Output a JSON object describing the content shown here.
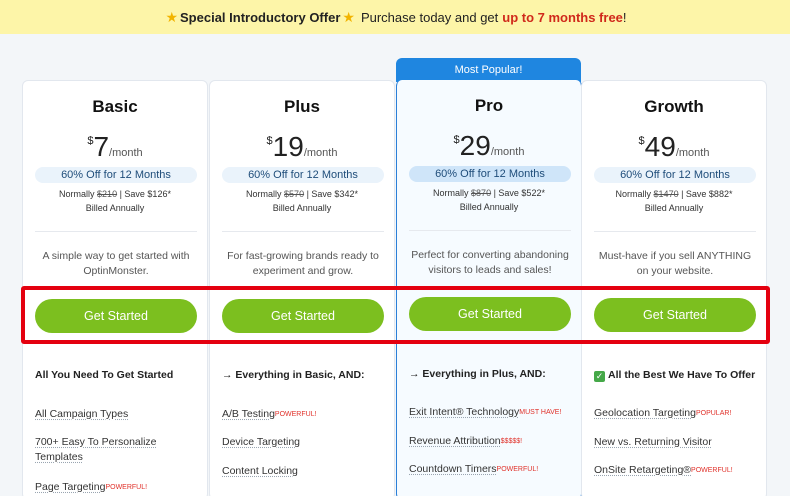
{
  "banner": {
    "prefix": "Special Introductory Offer",
    "middle": "Purchase today and get",
    "highlight": "up to 7 months free",
    "suffix": "!"
  },
  "popular_label": "Most Popular!",
  "plans": [
    {
      "name": "Basic",
      "currency": "$",
      "amount": "7",
      "per": "/month",
      "off": "60% Off for 12 Months",
      "normal_prefix": "Normally ",
      "normal_strike": "$210",
      "normal_suffix": " | Save $126*",
      "billed": "Billed Annually",
      "desc": "A simple way to get started with OptinMonster.",
      "cta": "Get Started",
      "features_head": "All You Need To Get Started",
      "features": [
        {
          "label": "All Campaign Types",
          "badge": ""
        },
        {
          "label": "700+ Easy To Personalize Templates",
          "badge": ""
        },
        {
          "label": "Page Targeting",
          "badge": "POWERFUL!"
        }
      ]
    },
    {
      "name": "Plus",
      "currency": "$",
      "amount": "19",
      "per": "/month",
      "off": "60% Off for 12 Months",
      "normal_prefix": "Normally ",
      "normal_strike": "$570",
      "normal_suffix": " | Save $342*",
      "billed": "Billed Annually",
      "desc": "For fast-growing brands ready to experiment and grow.",
      "cta": "Get Started",
      "features_head": "→ Everything in Basic, AND:",
      "features": [
        {
          "label": "A/B Testing",
          "badge": "POWERFUL!"
        },
        {
          "label": "Device Targeting",
          "badge": ""
        },
        {
          "label": "Content Locking",
          "badge": ""
        }
      ]
    },
    {
      "name": "Pro",
      "currency": "$",
      "amount": "29",
      "per": "/month",
      "off": "60% Off for 12 Months",
      "normal_prefix": "Normally ",
      "normal_strike": "$870",
      "normal_suffix": " | Save $522*",
      "billed": "Billed Annually",
      "desc": "Perfect for converting abandoning visitors to leads and sales!",
      "cta": "Get Started",
      "features_head": "→ Everything in Plus, AND:",
      "features": [
        {
          "label": "Exit Intent® Technology",
          "badge": "MUST HAVE!"
        },
        {
          "label": "Revenue Attribution",
          "badge": "$$$$$!"
        },
        {
          "label": "Countdown Timers",
          "badge": "POWERFUL!"
        }
      ]
    },
    {
      "name": "Growth",
      "currency": "$",
      "amount": "49",
      "per": "/month",
      "off": "60% Off for 12 Months",
      "normal_prefix": "Normally ",
      "normal_strike": "$1470",
      "normal_suffix": " | Save $882*",
      "billed": "Billed Annually",
      "desc": "Must-have if you sell ANYTHING on your website.",
      "cta": "Get Started",
      "features_head": "All the Best We Have To Offer",
      "features": [
        {
          "label": "Geolocation Targeting",
          "badge": "POPULAR!"
        },
        {
          "label": "New vs. Returning Visitor",
          "badge": ""
        },
        {
          "label": "OnSite Retargeting®",
          "badge": "POWERFUL!"
        }
      ]
    }
  ]
}
